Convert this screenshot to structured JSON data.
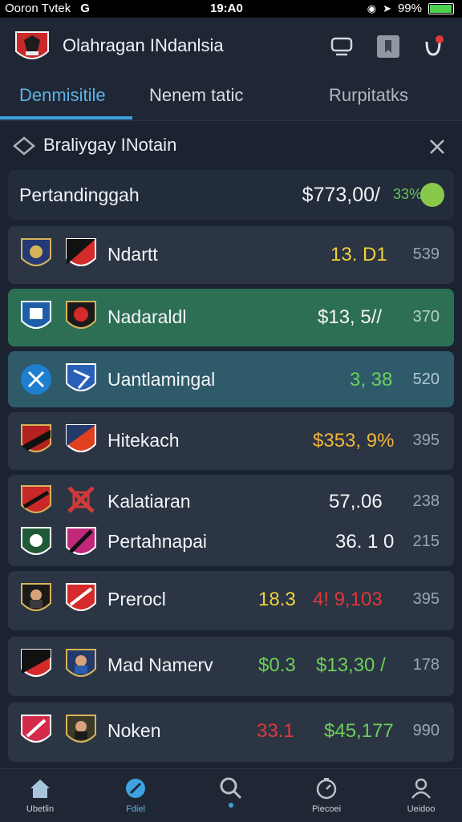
{
  "status": {
    "carrier": "Ooron Tvtek",
    "g": "G",
    "time": "19:A0",
    "battery": "99%",
    "battery_level": 0.9
  },
  "header": {
    "title": "Olahragan INdanlsia"
  },
  "tabs": [
    {
      "label": "Denmisitile"
    },
    {
      "label": "Nenem tatic"
    },
    {
      "label": "Rurpitatks"
    }
  ],
  "filter": {
    "label": "Braliygay INotain"
  },
  "summary": {
    "label": "Pertandinggah",
    "value": "$773,00/",
    "pct": "33%"
  },
  "rows": [
    {
      "team": "Ndartt",
      "value": "13. D1",
      "small": "539"
    },
    {
      "team": "Nadaraldl",
      "value": "$13, 5//",
      "small": "370"
    },
    {
      "team": "Uantlamingal",
      "value": "3, 38",
      "small": "520"
    },
    {
      "team": "Hitekach",
      "value": "$353, 9%",
      "small": "395"
    },
    {
      "team": "Kalatiaran",
      "value": "57,.06",
      "small": "238"
    },
    {
      "team": "Pertahnapai",
      "value": "36. 1 0",
      "small": "215"
    },
    {
      "team": "Prerocl",
      "value_a": "18.3",
      "value_b": "4! 9,103",
      "small": "395"
    },
    {
      "team": "Mad Namerv",
      "value_a": "$0.3",
      "value_b": "$13,30 /",
      "small": "178"
    },
    {
      "team": "Noken",
      "value_a": "33.1",
      "value_b": "$45,177",
      "small": "990"
    }
  ],
  "nav": [
    {
      "label": "Ubetlin"
    },
    {
      "label": "Fdiel"
    },
    {
      "label": ""
    },
    {
      "label": "Piecoei"
    },
    {
      "label": "Ueidoo"
    }
  ],
  "colors": {
    "accent": "#3fa2e0",
    "yellow": "#f2d13a",
    "green": "#6cd05a",
    "red": "#e0393a",
    "orange": "#f2b53a"
  }
}
